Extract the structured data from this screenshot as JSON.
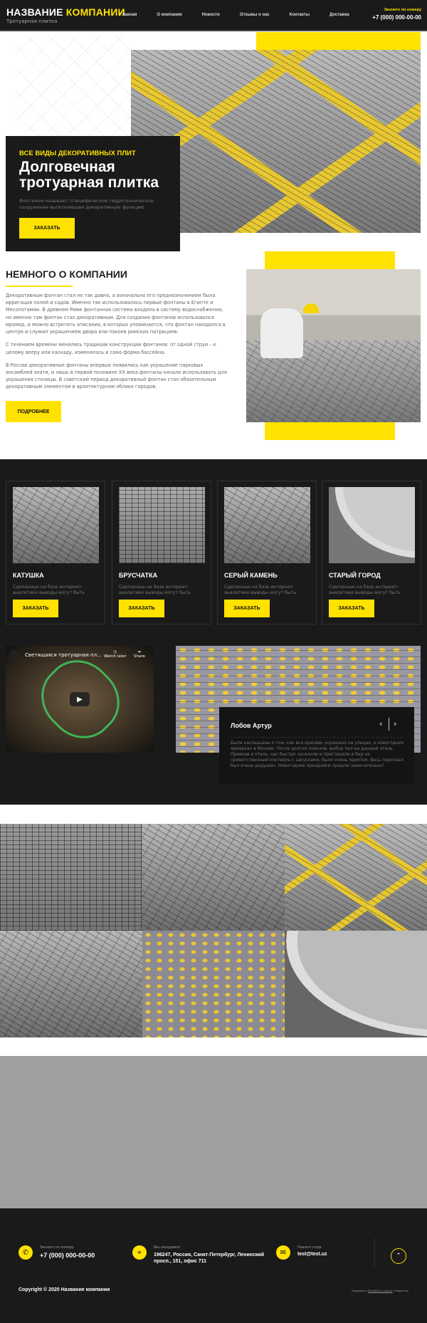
{
  "header": {
    "logo_part1": "НАЗВАНИЕ",
    "logo_part2": "КОМПАНИИ",
    "tagline": "Тротуарная плитка",
    "nav": [
      "Главная",
      "О компании",
      "Новости",
      "Отзывы о нас",
      "Контакты",
      "Доставка"
    ],
    "call_label": "Звоните по номеру",
    "phone": "+7 (000) 000-00-00"
  },
  "hero": {
    "kicker": "ВСЕ ВИДЫ ДЕКОРАТИВНЫХ ПЛИТ",
    "title": "Долговечная тротуарная плитка",
    "subtitle": "Фонтаном называют специфическое гидротехническое сооружение выполняющее декоративную функцию",
    "button": "ЗАКАЗАТЬ"
  },
  "about": {
    "title": "НЕМНОГО О КОМПАНИИ",
    "paragraphs": [
      "Декоративным фонтан стал не так давно, а изначально его предназначением была ирригация полей и садов. Именно так использовались первые фонтаны в Египте и Месопотамии. В древнем Риме фонтанная система входила в систему водоснабжения, но именно там фонтан стал декоративным. Для создания фонтанов использовался мрамор, и можно встретить описания, в которых упоминается, что фонтан находился в центре и служил украшением двора или покоев римских патрициев.",
      "С течением времени менялись традиции конструкции фонтанов: от одной струи – к целому вееру или каскаду, изменялась и сама форма бассейна.",
      "В России декоративные фонтаны впервые появились как украшение парковых ансамблей знати, и лишь в первой половине XX века фонтаны начали использовать для украшения столицы. В советский период декоративный фонтан стал обязательным декоративным элементом в архитектурном облике городов."
    ],
    "button": "ПОДРОБНЕЕ"
  },
  "products": [
    {
      "title": "КАТУШКА",
      "desc": "Сделанные на базе интернет-аналитики выводы могут быть",
      "button": "ЗАКАЗАТЬ"
    },
    {
      "title": "БРУСЧАТКА",
      "desc": "Сделанные на базе интернет-аналитики выводы могут быть",
      "button": "ЗАКАЗАТЬ"
    },
    {
      "title": "СЕРЫЙ КАМЕНЬ",
      "desc": "Сделанные на базе интернет-аналитики выводы могут быть",
      "button": "ЗАКАЗАТЬ"
    },
    {
      "title": "СТАРЫЙ ГОРОД",
      "desc": "Сделанные на базе интернет-аналитики выводы могут быть",
      "button": "ЗАКАЗАТЬ"
    }
  ],
  "video": {
    "title": "Светящаяся тротуарная пл...",
    "watch_later": "Watch later",
    "share": "Share"
  },
  "review": {
    "name": "Лобов Артур",
    "text": "Были наслышаны о том, как все красиво украшено на улицах, о новогодних ярмарках в Москве. После долгих поисков, выбор пал на данный отель. Приехав в отель, нас быстро заселили и пригласили в бар на приветственный коктейль с закусками, было очень приятно. Весь персонал был очень радушен. Новогодние праздники прошли замечательно!"
  },
  "footer": {
    "phone_label": "Звоните по номеру",
    "phone": "+7 (000) 000-00-00",
    "address_label": "Мы находимся",
    "address": "196247, Россия, Санкт-Петербург, Ленинский просп., 151, офис 711",
    "email_label": "Пишите сюда",
    "email": "test@test.uz",
    "copyright": "Copyright © 2020 Название компании",
    "credit_prefix": "Поддержка",
    "credit_link": "Разработка сайтов",
    "credit_suffix": "в Маркетир"
  },
  "colors": {
    "accent": "#ffe200",
    "dark": "#1a1a1a"
  }
}
